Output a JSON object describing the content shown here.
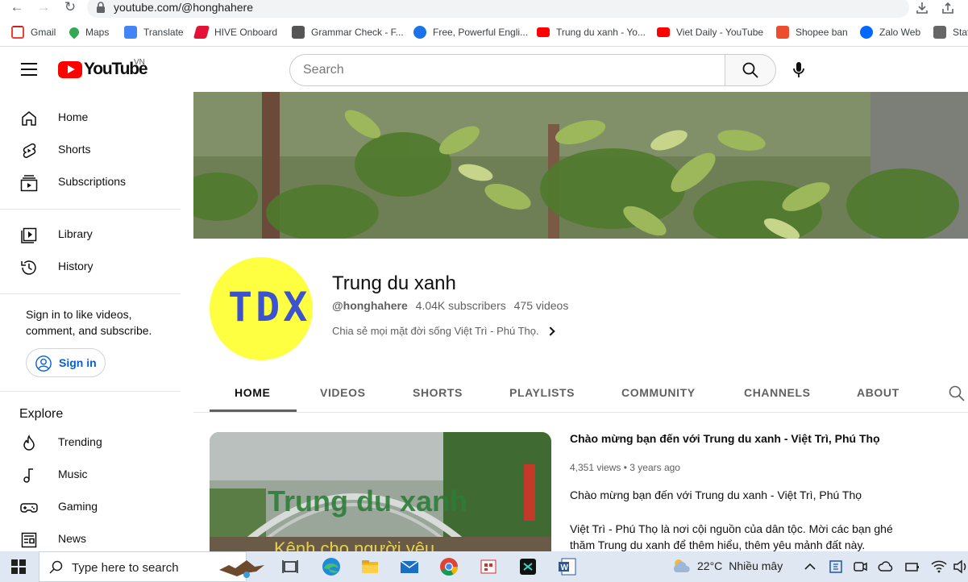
{
  "browser": {
    "url": "youtube.com/@honghahere",
    "bookmarks": [
      {
        "label": "Gmail",
        "icon": "gmail-icon",
        "color": "#ea4335"
      },
      {
        "label": "Maps",
        "icon": "maps-icon",
        "color": "#34a853"
      },
      {
        "label": "Translate",
        "icon": "translate-icon",
        "color": "#4285f4"
      },
      {
        "label": "HIVE Onboard",
        "icon": "hive-icon",
        "color": "#e31337"
      },
      {
        "label": "Grammar Check - F...",
        "icon": "grammar-icon",
        "color": "#555555"
      },
      {
        "label": "Free, Powerful Engli...",
        "icon": "english-icon",
        "color": "#1a73e8"
      },
      {
        "label": "Trung du xanh - Yo...",
        "icon": "youtube-icon",
        "color": "#ff0000"
      },
      {
        "label": "Viet Daily - YouTube",
        "icon": "youtube-icon",
        "color": "#ff0000"
      },
      {
        "label": "Shopee ban",
        "icon": "shopee-icon",
        "color": "#ee4d2d"
      },
      {
        "label": "Zalo Web",
        "icon": "zalo-icon",
        "color": "#0068ff"
      },
      {
        "label": "Stat",
        "icon": "stat-icon",
        "color": "#666666"
      }
    ]
  },
  "masthead": {
    "logo_text": "YouTube",
    "country_code": "VN",
    "search_placeholder": "Search"
  },
  "sidebar": {
    "items": [
      {
        "label": "Home",
        "icon": "home-icon"
      },
      {
        "label": "Shorts",
        "icon": "shorts-icon"
      },
      {
        "label": "Subscriptions",
        "icon": "subscriptions-icon"
      },
      {
        "label": "Library",
        "icon": "library-icon"
      },
      {
        "label": "History",
        "icon": "history-icon"
      }
    ],
    "signin_prompt": "Sign in to like videos, comment, and subscribe.",
    "signin_label": "Sign in",
    "explore_title": "Explore",
    "explore_items": [
      {
        "label": "Trending",
        "icon": "trending-icon"
      },
      {
        "label": "Music",
        "icon": "music-icon"
      },
      {
        "label": "Gaming",
        "icon": "gaming-icon"
      },
      {
        "label": "News",
        "icon": "news-icon"
      }
    ]
  },
  "channel": {
    "avatar_text": "TDX",
    "name": "Trung du xanh",
    "handle": "@honghahere",
    "subscribers": "4.04K subscribers",
    "videos": "475 videos",
    "description": "Chia sẻ mọi mặt đời sống Việt Trì - Phú Thọ."
  },
  "tabs": [
    {
      "label": "HOME",
      "active": true
    },
    {
      "label": "VIDEOS",
      "active": false
    },
    {
      "label": "SHORTS",
      "active": false
    },
    {
      "label": "PLAYLISTS",
      "active": false
    },
    {
      "label": "COMMUNITY",
      "active": false
    },
    {
      "label": "CHANNELS",
      "active": false
    },
    {
      "label": "ABOUT",
      "active": false
    }
  ],
  "featured": {
    "thumb_text": "Trung du xanh",
    "thumb_subtext": "Kênh cho người yêu",
    "title": "Chào mừng bạn đến với Trung du xanh - Việt Trì, Phú Thọ",
    "views": "4,351 views",
    "age": "3 years ago",
    "desc_line1": "Chào mừng bạn đến với Trung du xanh - Việt Trì, Phú Thọ",
    "desc_line2": "Việt Trì - Phú Thọ là nơi cội nguồn của dân tộc. Mời các bạn ghé thăm Trung du xanh để thêm hiểu, thêm yêu mảnh đất này."
  },
  "taskbar": {
    "search_placeholder": "Type here to search",
    "temperature": "22°C",
    "weather": "Nhiều mây"
  }
}
